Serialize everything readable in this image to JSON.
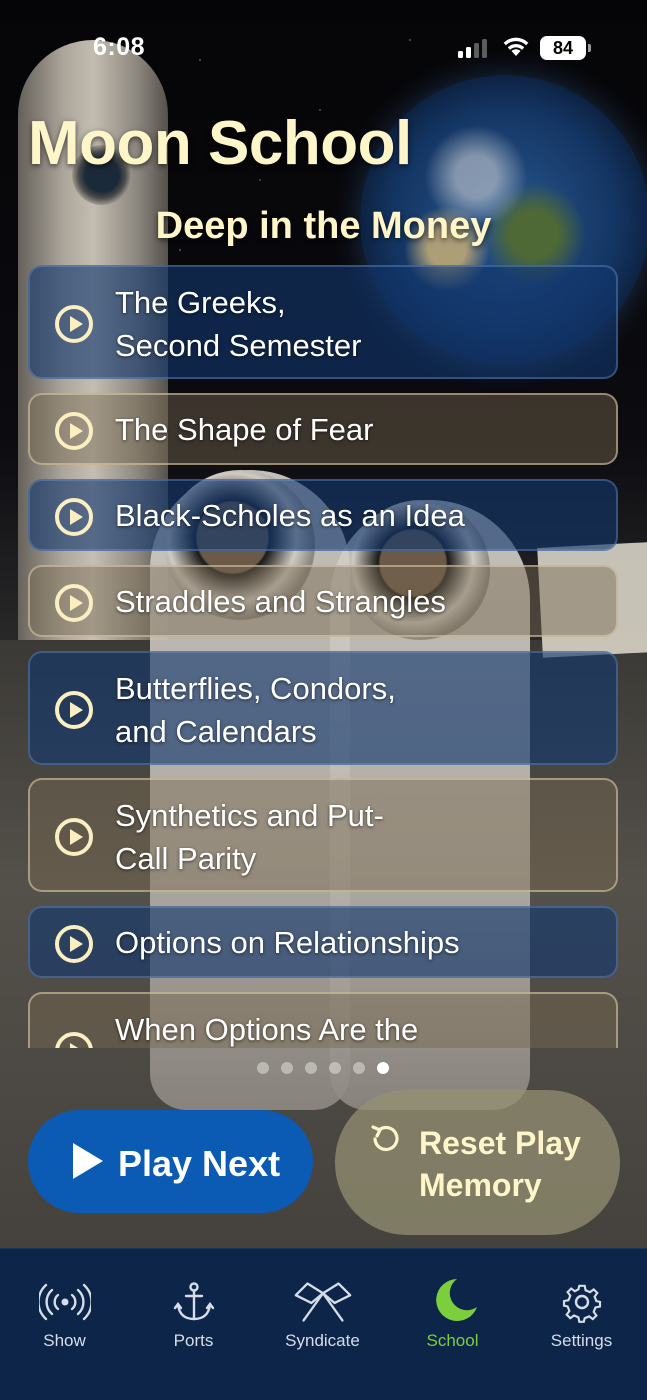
{
  "status_bar": {
    "time": "6:08",
    "battery": "84"
  },
  "header": {
    "title": "Moon School",
    "subtitle": "Deep in the Money"
  },
  "episodes": [
    {
      "label": "The Greeks,\nSecond Semester",
      "style": "blue"
    },
    {
      "label": "The Shape of Fear",
      "style": "tan"
    },
    {
      "label": "Black-Scholes as an Idea",
      "style": "blue"
    },
    {
      "label": "Straddles and Strangles",
      "style": "tan"
    },
    {
      "label": "Butterflies, Condors,\nand Calendars",
      "style": "blue"
    },
    {
      "label": "Synthetics and Put-\nCall Parity",
      "style": "tan"
    },
    {
      "label": "Options on Relationships",
      "style": "blue"
    },
    {
      "label": "When Options Are the",
      "style": "tan"
    }
  ],
  "pager": {
    "count": 6,
    "active_index": 5
  },
  "actions": {
    "play_next": "Play Next",
    "reset": "Reset Play\nMemory"
  },
  "tabs": [
    {
      "label": "Show",
      "icon": "broadcast-icon",
      "active": false
    },
    {
      "label": "Ports",
      "icon": "anchor-icon",
      "active": false
    },
    {
      "label": "Syndicate",
      "icon": "flags-icon",
      "active": false
    },
    {
      "label": "School",
      "icon": "moon-icon",
      "active": true
    },
    {
      "label": "Settings",
      "icon": "gear-icon",
      "active": false
    }
  ],
  "colors": {
    "title": "#fef5c8",
    "play_button": "#0b5ab4",
    "active_tab": "#7ccf3c",
    "tab_bar": "#0c2548"
  }
}
